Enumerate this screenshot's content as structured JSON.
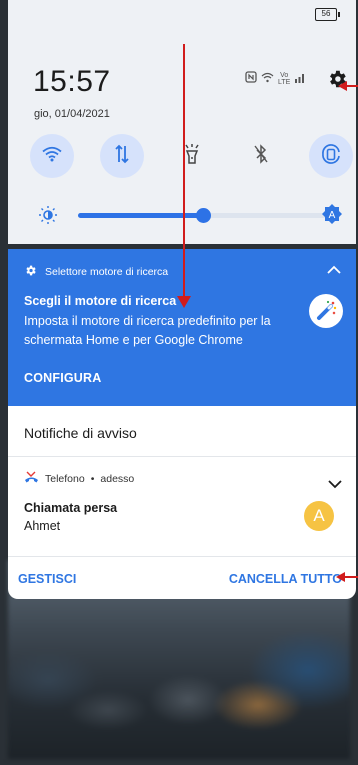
{
  "status_bar": {
    "battery": "56"
  },
  "header": {
    "clock": "15:57",
    "date": "gio, 01/04/2021",
    "signal_labels": {
      "vo": "Vo",
      "lte": "LTE"
    }
  },
  "quick_settings": {
    "tiles": [
      {
        "icon": "wifi-icon",
        "active": true
      },
      {
        "icon": "mobile-data-icon",
        "active": true
      },
      {
        "icon": "flashlight-icon",
        "active": false
      },
      {
        "icon": "bluetooth-off-icon",
        "active": false
      },
      {
        "icon": "rotation-lock-icon",
        "active": true
      }
    ],
    "brightness": {
      "level": 0.5,
      "auto_label": "A"
    }
  },
  "search_notification": {
    "app_name": "Selettore motore di ricerca",
    "title": "Scegli il motore di ricerca",
    "text": "Imposta il motore di ricerca predefinito per la schermata Home e per Google Chrome",
    "action": "CONFIGURA"
  },
  "alerts_section": {
    "title": "Notifiche di avviso"
  },
  "missed_call": {
    "app": "Telefono",
    "separator": "•",
    "time": "adesso",
    "title": "Chiamata persa",
    "caller": "Ahmet",
    "avatar_letter": "A"
  },
  "footer": {
    "manage": "GESTISCI",
    "clear_all": "CANCELLA TUTTO"
  },
  "colors": {
    "accent": "#2f76e2",
    "annotation": "#d11c1c",
    "avatar": "#f6c343",
    "tile_active": "#d6e2fb"
  }
}
